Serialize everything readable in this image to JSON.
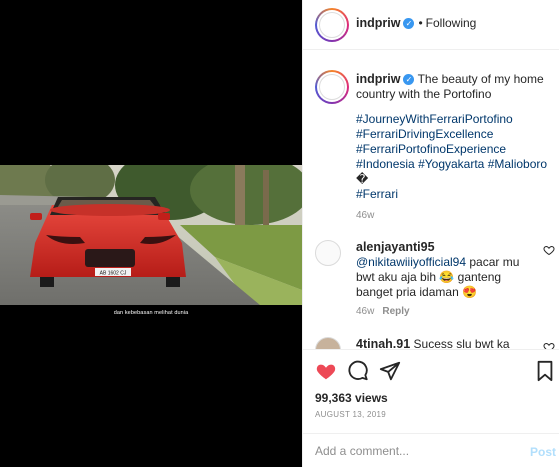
{
  "media": {
    "subtitle": "dan kebebasan melihat dunia",
    "plate": "AB 1602 CJ"
  },
  "header": {
    "username": "indpriw",
    "separator": "•",
    "follow_status": "Following"
  },
  "caption": {
    "username": "indpriw",
    "text": "The beauty of my home country with the Portofino",
    "hashtags": [
      "#JourneyWithFerrariPortofino",
      "#FerrariDrivingExcellence",
      "#FerrariPortofinoExperience"
    ],
    "line4_tags": [
      "#Indonesia",
      "#Yogyakarta",
      "#Malioboro"
    ],
    "emoji": "�",
    "last_tag": "#Ferrari",
    "time": "46w"
  },
  "comments": [
    {
      "username": "alenjayanti95",
      "mention": "@nikitawiiiyofficial94",
      "text": "pacar mu bwt aku aja bih 😂 ganteng banget pria idaman 😍",
      "time": "46w",
      "reply": "Reply"
    },
    {
      "username": "4tinah.91",
      "text": "Sucess slu bwt ka"
    }
  ],
  "actions": {
    "icons": [
      "heart-filled-icon",
      "comment-icon",
      "share-icon",
      "bookmark-icon"
    ],
    "heart_color": "#ed4956"
  },
  "likes": "99,363 views",
  "date": "AUGUST 13, 2019",
  "add_comment": {
    "placeholder": "Add a comment...",
    "post_label": "Post"
  }
}
